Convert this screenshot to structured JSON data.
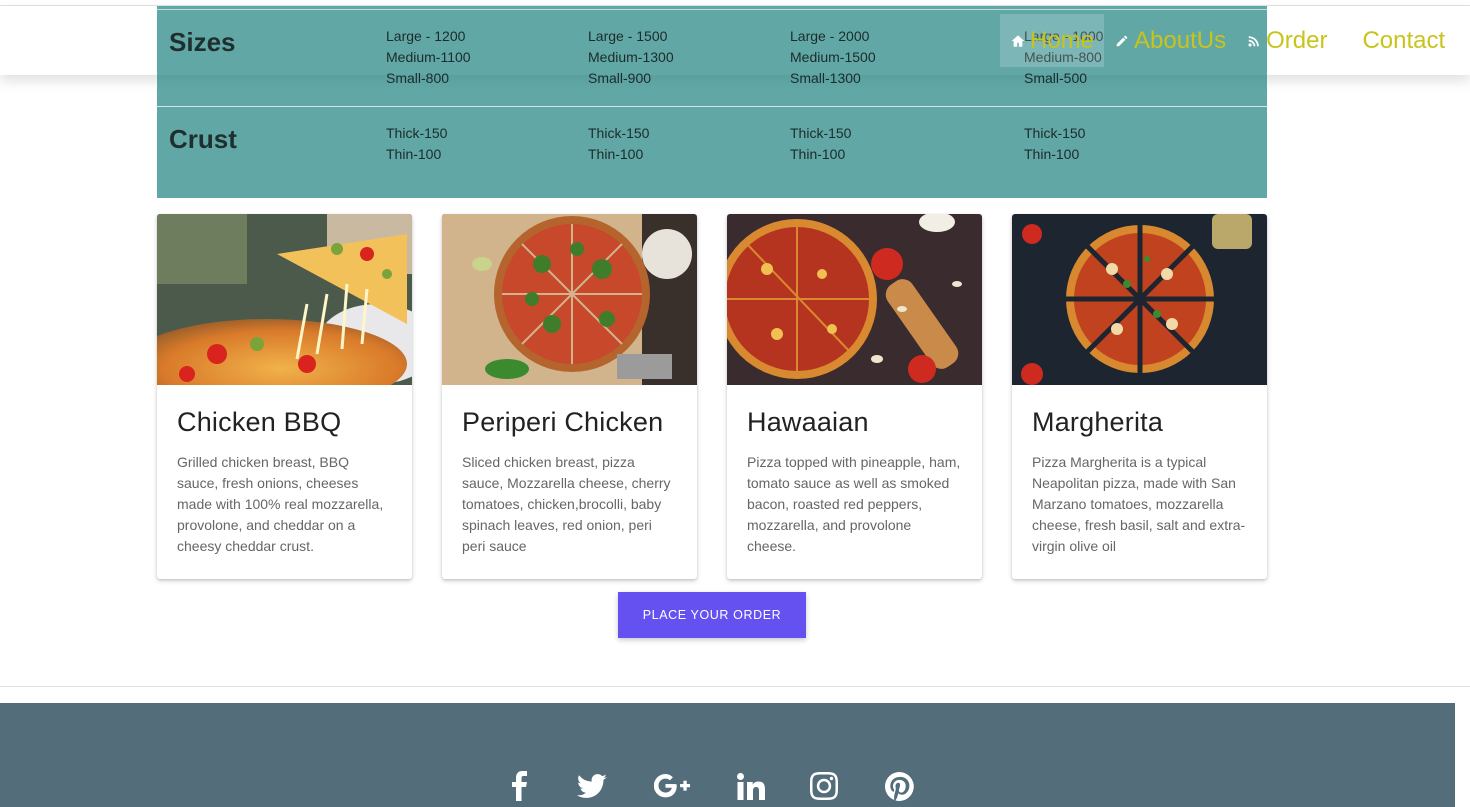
{
  "nav": {
    "items": [
      {
        "label": "Home",
        "icon": "home-icon",
        "active": true
      },
      {
        "label": "AboutUs",
        "icon": "pencil-icon",
        "active": false
      },
      {
        "label": "Order",
        "icon": "rss-icon",
        "active": false
      },
      {
        "label": "Contact",
        "icon": "",
        "active": false
      }
    ],
    "link_color": "#c9c41a"
  },
  "pricing": {
    "sizes": {
      "heading": "Sizes",
      "columns": [
        "Large - 1200\nMedium-1100\nSmall-800",
        "Large - 1500\nMedium-1300\nSmall-900",
        "Large - 2000\nMedium-1500\nSmall-1300",
        "Large - 1000\nMedium-800\nSmall-500"
      ]
    },
    "crust": {
      "heading": "Crust",
      "columns": [
        "Thick-150\nThin-100",
        "Thick-150\nThin-100",
        "Thick-150\nThin-100",
        "Thick-150\nThin-100"
      ]
    },
    "background": "#268785"
  },
  "cards": [
    {
      "title": "Chicken BBQ",
      "description": "Grilled chicken breast, BBQ sauce, fresh onions, cheeses made with 100% real mozzarella, provolone, and cheddar on a cheesy cheddar crust."
    },
    {
      "title": "Periperi Chicken",
      "description": "Sliced chicken breast, pizza sauce, Mozzarella cheese, cherry tomatoes, chicken,brocolli, baby spinach leaves, red onion, peri peri sauce"
    },
    {
      "title": "Hawaaian",
      "description": "Pizza topped with pineapple, ham, tomato sauce as well as smoked bacon, roasted red peppers, mozzarella, and provolone cheese."
    },
    {
      "title": "Margherita",
      "description": "Pizza Margherita is a typical Neapolitan pizza, made with San Marzano tomatoes, mozzarella cheese, fresh basil, salt and extra-virgin olive oil"
    }
  ],
  "order_button": {
    "label": "PLACE YOUR ORDER",
    "color": "#6550f0"
  },
  "footer": {
    "background": "#546d7b",
    "social": [
      "facebook-icon",
      "twitter-icon",
      "google-plus-icon",
      "linkedin-icon",
      "instagram-icon",
      "pinterest-icon"
    ]
  }
}
